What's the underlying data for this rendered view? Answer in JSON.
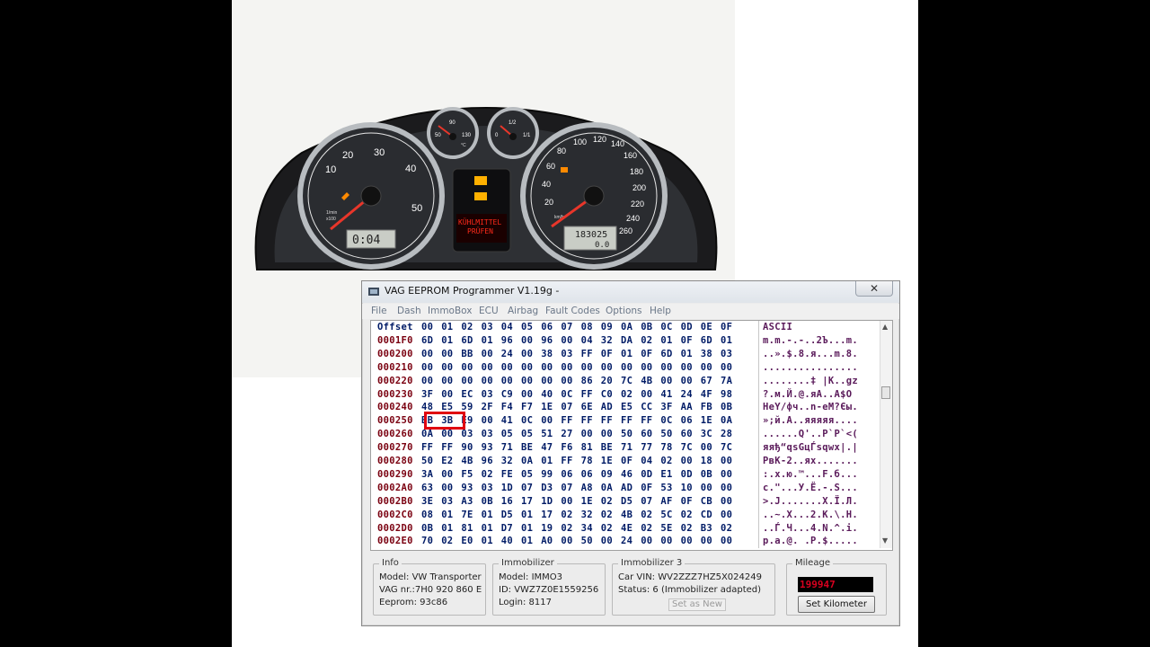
{
  "cluster": {
    "lcd_left": "0:04",
    "lcd_right_odometer": "183025",
    "lcd_right_trip": "0.0",
    "warning_text_1": "KÜHLMITTEL",
    "warning_text_2": "PRÜFEN",
    "tacho_labels": [
      "10",
      "20",
      "30",
      "40",
      "50"
    ],
    "tacho_unit_1": "1/min",
    "tacho_unit_2": "x100",
    "speedo_labels": [
      "20",
      "40",
      "60",
      "80",
      "100",
      "120",
      "140",
      "160",
      "180",
      "200",
      "220",
      "240",
      "260"
    ],
    "speedo_unit": "km/h",
    "temp_labels": [
      "50",
      "90",
      "130"
    ],
    "temp_unit": "°C",
    "fuel_labels": [
      "0",
      "1/2",
      "1/1"
    ]
  },
  "window": {
    "title": "VAG EEPROM Programmer  V1.19g -",
    "close_label": "✕",
    "menu": [
      "File",
      "Dash",
      "ImmoBox",
      "ECU",
      "Airbag",
      "Fault Codes",
      "Options",
      "Help"
    ]
  },
  "hex": {
    "header_offset": "Offset",
    "header_cols": [
      "00",
      "01",
      "02",
      "03",
      "04",
      "05",
      "06",
      "07",
      "08",
      "09",
      "0A",
      "0B",
      "0C",
      "0D",
      "0E",
      "0F"
    ],
    "header_ascii": "ASCII",
    "rows": [
      {
        "off": "0001F0",
        "bytes": [
          "6D",
          "01",
          "6D",
          "01",
          "96",
          "00",
          "96",
          "00",
          "04",
          "32",
          "DA",
          "02",
          "01",
          "0F",
          "6D",
          "01"
        ],
        "ascii": "m.m.-.-..2Ъ...m."
      },
      {
        "off": "000200",
        "bytes": [
          "00",
          "00",
          "BB",
          "00",
          "24",
          "00",
          "38",
          "03",
          "FF",
          "0F",
          "01",
          "0F",
          "6D",
          "01",
          "38",
          "03"
        ],
        "ascii": "..».$.8.я...m.8."
      },
      {
        "off": "000210",
        "bytes": [
          "00",
          "00",
          "00",
          "00",
          "00",
          "00",
          "00",
          "00",
          "00",
          "00",
          "00",
          "00",
          "00",
          "00",
          "00",
          "00"
        ],
        "ascii": "................"
      },
      {
        "off": "000220",
        "bytes": [
          "00",
          "00",
          "00",
          "00",
          "00",
          "00",
          "00",
          "00",
          "86",
          "20",
          "7C",
          "4B",
          "00",
          "00",
          "67",
          "7A"
        ],
        "ascii": "........‡ |K..gz"
      },
      {
        "off": "000230",
        "bytes": [
          "3F",
          "00",
          "EC",
          "03",
          "C9",
          "00",
          "40",
          "0C",
          "FF",
          "C0",
          "02",
          "00",
          "41",
          "24",
          "4F",
          "98"
        ],
        "ascii": "?.м.Й.@.яА..A$O"
      },
      {
        "off": "000240",
        "bytes": [
          "48",
          "E5",
          "59",
          "2F",
          "F4",
          "F7",
          "1E",
          "07",
          "6E",
          "AD",
          "E5",
          "CC",
          "3F",
          "AA",
          "FB",
          "0B"
        ],
        "ascii": "HeY/фч..n-eМ?Єы."
      },
      {
        "off": "000250",
        "bytes": [
          "BB",
          "3B",
          "E9",
          "00",
          "41",
          "0C",
          "00",
          "FF",
          "FF",
          "FF",
          "FF",
          "FF",
          "0C",
          "06",
          "1E",
          "0A"
        ],
        "ascii": "»;й.A..яяяяя...."
      },
      {
        "off": "000260",
        "bytes": [
          "0A",
          "00",
          "03",
          "03",
          "05",
          "05",
          "51",
          "27",
          "00",
          "00",
          "50",
          "60",
          "50",
          "60",
          "3C",
          "28"
        ],
        "ascii": "......Q'..P`P`<("
      },
      {
        "off": "000270",
        "bytes": [
          "FF",
          "FF",
          "90",
          "93",
          "71",
          "BE",
          "47",
          "F6",
          "81",
          "BE",
          "71",
          "77",
          "78",
          "7C",
          "00",
          "7C"
        ],
        "ascii": "яяђ“qsGцЃsqwx|.|"
      },
      {
        "off": "000280",
        "bytes": [
          "50",
          "E2",
          "4B",
          "96",
          "32",
          "0A",
          "01",
          "FF",
          "78",
          "1E",
          "0F",
          "04",
          "02",
          "00",
          "18",
          "00"
        ],
        "ascii": "PвK-2..яx......."
      },
      {
        "off": "000290",
        "bytes": [
          "3A",
          "00",
          "F5",
          "02",
          "FE",
          "05",
          "99",
          "06",
          "06",
          "09",
          "46",
          "0D",
          "E1",
          "0D",
          "0B",
          "00"
        ],
        "ascii": ":.х.ю.™...F.б..."
      },
      {
        "off": "0002A0",
        "bytes": [
          "63",
          "00",
          "93",
          "03",
          "1D",
          "07",
          "D3",
          "07",
          "A8",
          "0A",
          "AD",
          "0F",
          "53",
          "10",
          "00",
          "00"
        ],
        "ascii": "c.\"...У.Ё.-.S..."
      },
      {
        "off": "0002B0",
        "bytes": [
          "3E",
          "03",
          "A3",
          "0B",
          "16",
          "17",
          "1D",
          "00",
          "1E",
          "02",
          "D5",
          "07",
          "AF",
          "0F",
          "CB",
          "00"
        ],
        "ascii": ">.J.......Х.Ї.Л."
      },
      {
        "off": "0002C0",
        "bytes": [
          "08",
          "01",
          "7E",
          "01",
          "D5",
          "01",
          "17",
          "02",
          "32",
          "02",
          "4B",
          "02",
          "5C",
          "02",
          "CD",
          "00"
        ],
        "ascii": "..~.Х...2.K.\\.Н."
      },
      {
        "off": "0002D0",
        "bytes": [
          "0B",
          "01",
          "81",
          "01",
          "D7",
          "01",
          "19",
          "02",
          "34",
          "02",
          "4E",
          "02",
          "5E",
          "02",
          "B3",
          "02"
        ],
        "ascii": "..Ѓ.Ч...4.N.^.і."
      },
      {
        "off": "0002E0",
        "bytes": [
          "70",
          "02",
          "E0",
          "01",
          "40",
          "01",
          "A0",
          "00",
          "50",
          "00",
          "24",
          "00",
          "00",
          "00",
          "00",
          "00"
        ],
        "ascii": "p.а.@. .P.$....."
      }
    ]
  },
  "info": {
    "legend": "Info",
    "model": "Model:  VW Transporter",
    "vag_nr": "VAG nr.:7H0 920 860 E",
    "eeprom": "Eeprom: 93c86"
  },
  "immobilizer": {
    "legend": "Immobilizer",
    "model": "Model:   IMMO3",
    "id": "ID: VWZ7Z0E1559256",
    "login": "Login: 8117"
  },
  "immobilizer3": {
    "legend": "Immobilizer 3",
    "vin": "Car VIN: WV2ZZZ7HZ5X024249",
    "status": "Status: 6 (Immobilizer adapted)",
    "set_as_new": "Set as New"
  },
  "mileage": {
    "legend": "Mileage",
    "value": "199947",
    "button": "Set Kilometer"
  },
  "colors": {
    "needle": "#e8362a",
    "warning_red": "#ff2a1a",
    "lcd_bg": "#c9cdc6",
    "hex_text": "#001b66",
    "offset_text": "#7a0010",
    "mileage_red": "#d8001f"
  }
}
